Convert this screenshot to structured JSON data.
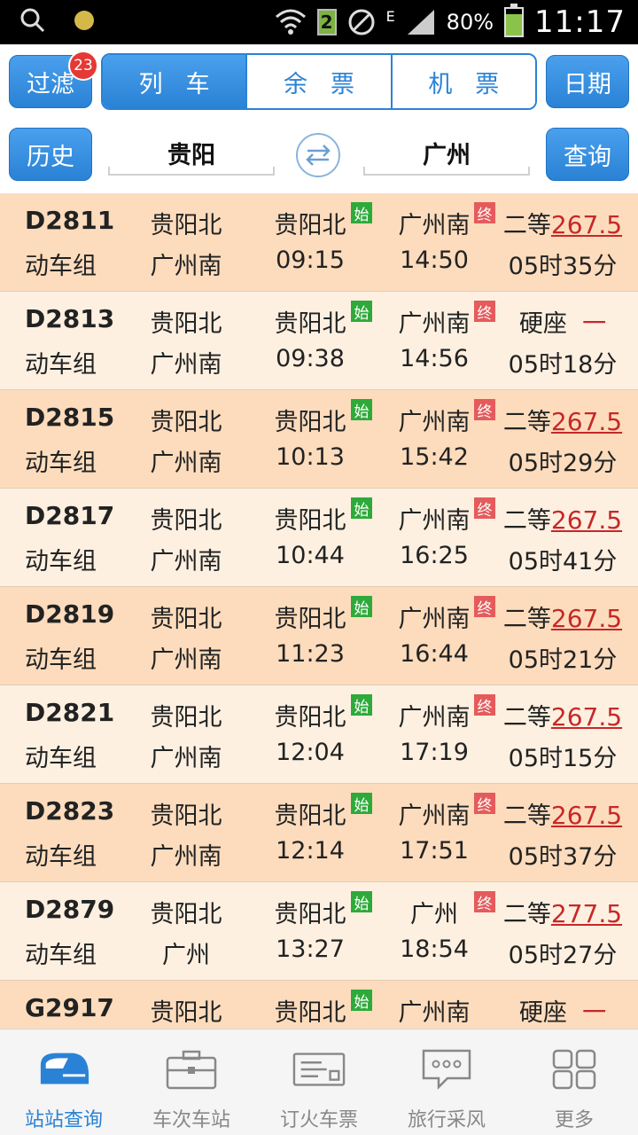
{
  "status_bar": {
    "wifi_sim": "2",
    "network": "E",
    "battery": "80%",
    "time": "11:17"
  },
  "top": {
    "filter_label": "过滤",
    "filter_badge": "23",
    "tabs": [
      {
        "label": "列车",
        "active": true
      },
      {
        "label": "余票",
        "active": false
      },
      {
        "label": "机票",
        "active": false
      }
    ],
    "date_label": "日期",
    "history_label": "历史",
    "from_station": "贵阳",
    "to_station": "广州",
    "query_label": "查询"
  },
  "trains": [
    {
      "code": "D2811",
      "type": "动车组",
      "from": "贵阳北",
      "to": "广州南",
      "dep_station": "贵阳北",
      "arr_station": "广州南",
      "dep": "09:15",
      "arr": "14:50",
      "seat": "二等",
      "price": "267.5",
      "duration": "05时35分"
    },
    {
      "code": "D2813",
      "type": "动车组",
      "from": "贵阳北",
      "to": "广州南",
      "dep_station": "贵阳北",
      "arr_station": "广州南",
      "dep": "09:38",
      "arr": "14:56",
      "seat": "硬座",
      "price": "一",
      "duration": "05时18分"
    },
    {
      "code": "D2815",
      "type": "动车组",
      "from": "贵阳北",
      "to": "广州南",
      "dep_station": "贵阳北",
      "arr_station": "广州南",
      "dep": "10:13",
      "arr": "15:42",
      "seat": "二等",
      "price": "267.5",
      "duration": "05时29分"
    },
    {
      "code": "D2817",
      "type": "动车组",
      "from": "贵阳北",
      "to": "广州南",
      "dep_station": "贵阳北",
      "arr_station": "广州南",
      "dep": "10:44",
      "arr": "16:25",
      "seat": "二等",
      "price": "267.5",
      "duration": "05时41分"
    },
    {
      "code": "D2819",
      "type": "动车组",
      "from": "贵阳北",
      "to": "广州南",
      "dep_station": "贵阳北",
      "arr_station": "广州南",
      "dep": "11:23",
      "arr": "16:44",
      "seat": "二等",
      "price": "267.5",
      "duration": "05时21分"
    },
    {
      "code": "D2821",
      "type": "动车组",
      "from": "贵阳北",
      "to": "广州南",
      "dep_station": "贵阳北",
      "arr_station": "广州南",
      "dep": "12:04",
      "arr": "17:19",
      "seat": "二等",
      "price": "267.5",
      "duration": "05时15分"
    },
    {
      "code": "D2823",
      "type": "动车组",
      "from": "贵阳北",
      "to": "广州南",
      "dep_station": "贵阳北",
      "arr_station": "广州南",
      "dep": "12:14",
      "arr": "17:51",
      "seat": "二等",
      "price": "267.5",
      "duration": "05时37分"
    },
    {
      "code": "D2879",
      "type": "动车组",
      "from": "贵阳北",
      "to": "广州",
      "dep_station": "贵阳北",
      "arr_station": "广州",
      "dep": "13:27",
      "arr": "18:54",
      "seat": "二等",
      "price": "277.5",
      "duration": "05时27分"
    },
    {
      "code": "G2917",
      "type": "",
      "from": "贵阳北",
      "to": "",
      "dep_station": "贵阳北",
      "arr_station": "广州南",
      "dep": "",
      "arr": "",
      "seat": "硬座",
      "price": "一",
      "duration": ""
    }
  ],
  "tags": {
    "start": "始",
    "end": "终"
  },
  "bottom_nav": [
    {
      "label": "站站查询",
      "icon": "train-icon",
      "active": true
    },
    {
      "label": "车次车站",
      "icon": "briefcase-icon",
      "active": false
    },
    {
      "label": "订火车票",
      "icon": "ticket-icon",
      "active": false
    },
    {
      "label": "旅行采风",
      "icon": "chat-icon",
      "active": false
    },
    {
      "label": "更多",
      "icon": "grid-icon",
      "active": false
    }
  ],
  "colors": {
    "accent": "#2a82d6",
    "row_odd": "#fcdcbd",
    "row_even": "#fdf0e1",
    "price": "#c62828",
    "start_tag": "#2eaa3a",
    "end_tag": "#e55b5b"
  }
}
